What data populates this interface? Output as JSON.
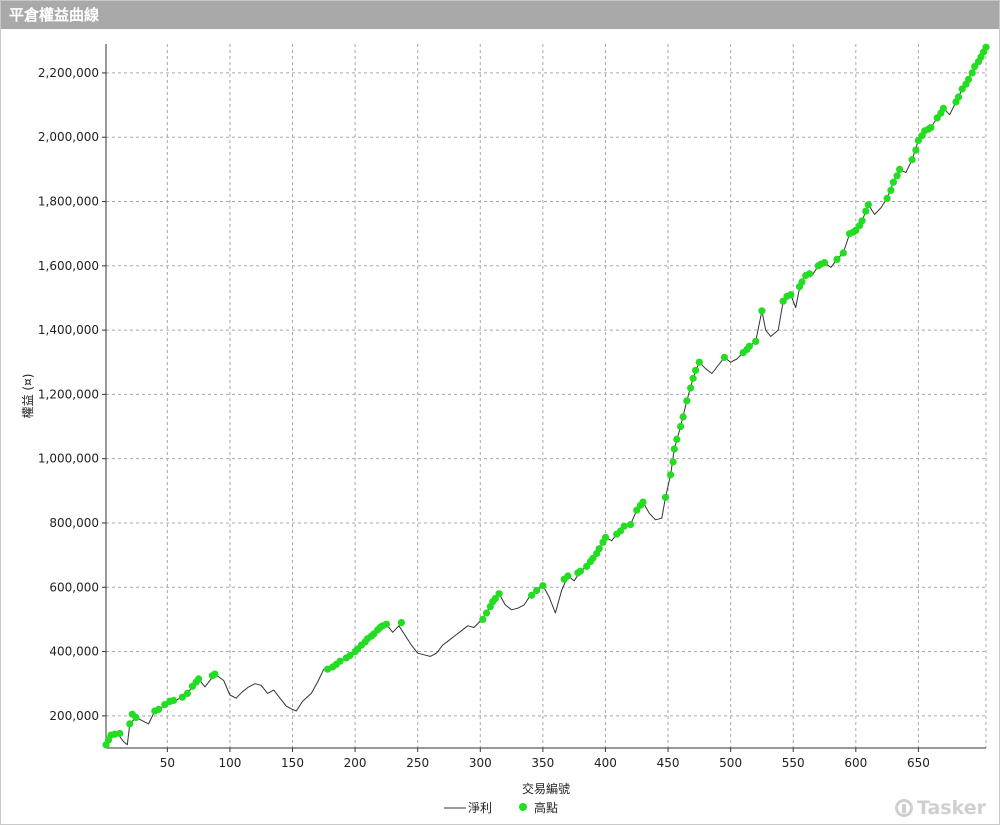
{
  "window": {
    "title": "平倉權益曲線"
  },
  "watermark": {
    "text": "Tasker"
  },
  "chart_data": {
    "type": "line",
    "ylabel": "權益 (¤)",
    "xlabel": "交易編號",
    "xlim": [
      1,
      704
    ],
    "ylim": [
      100000,
      2290000
    ],
    "x_ticks": [
      50,
      100,
      150,
      200,
      250,
      300,
      350,
      400,
      450,
      500,
      550,
      600,
      650
    ],
    "y_ticks": [
      200000,
      400000,
      600000,
      800000,
      1000000,
      1200000,
      1400000,
      1600000,
      1800000,
      2000000,
      2200000
    ],
    "y_tick_labels": [
      "200,000",
      "400,000",
      "600,000",
      "800,000",
      "1,000,000",
      "1,200,000",
      "1,400,000",
      "1,600,000",
      "1,800,000",
      "2,000,000",
      "2,200,000"
    ],
    "grid": true,
    "legend": {
      "position": "bottom",
      "items": [
        {
          "name": "淨利",
          "marker": "line",
          "color": "#333333"
        },
        {
          "name": "高點",
          "marker": "dot",
          "color": "#22dd22"
        }
      ]
    },
    "series": [
      {
        "name": "淨利",
        "color": "#333333",
        "points": [
          [
            1,
            110000
          ],
          [
            5,
            140000
          ],
          [
            10,
            145000
          ],
          [
            15,
            120000
          ],
          [
            18,
            110000
          ],
          [
            20,
            175000
          ],
          [
            25,
            195000
          ],
          [
            30,
            185000
          ],
          [
            35,
            175000
          ],
          [
            40,
            215000
          ],
          [
            45,
            225000
          ],
          [
            50,
            240000
          ],
          [
            55,
            245000
          ],
          [
            60,
            255000
          ],
          [
            65,
            265000
          ],
          [
            70,
            290000
          ],
          [
            75,
            315000
          ],
          [
            80,
            290000
          ],
          [
            88,
            330000
          ],
          [
            95,
            310000
          ],
          [
            100,
            265000
          ],
          [
            105,
            255000
          ],
          [
            110,
            275000
          ],
          [
            115,
            290000
          ],
          [
            120,
            300000
          ],
          [
            125,
            295000
          ],
          [
            130,
            270000
          ],
          [
            135,
            280000
          ],
          [
            140,
            255000
          ],
          [
            145,
            230000
          ],
          [
            150,
            220000
          ],
          [
            153,
            215000
          ],
          [
            158,
            245000
          ],
          [
            165,
            270000
          ],
          [
            170,
            305000
          ],
          [
            175,
            345000
          ],
          [
            185,
            360000
          ],
          [
            190,
            375000
          ],
          [
            195,
            385000
          ],
          [
            200,
            400000
          ],
          [
            205,
            420000
          ],
          [
            210,
            440000
          ],
          [
            215,
            455000
          ],
          [
            220,
            475000
          ],
          [
            225,
            485000
          ],
          [
            230,
            460000
          ],
          [
            235,
            480000
          ],
          [
            240,
            450000
          ],
          [
            245,
            420000
          ],
          [
            250,
            395000
          ],
          [
            255,
            390000
          ],
          [
            260,
            385000
          ],
          [
            265,
            395000
          ],
          [
            270,
            420000
          ],
          [
            275,
            435000
          ],
          [
            280,
            450000
          ],
          [
            285,
            465000
          ],
          [
            290,
            480000
          ],
          [
            295,
            475000
          ],
          [
            300,
            495000
          ],
          [
            305,
            520000
          ],
          [
            310,
            555000
          ],
          [
            315,
            580000
          ],
          [
            320,
            545000
          ],
          [
            325,
            530000
          ],
          [
            330,
            535000
          ],
          [
            335,
            545000
          ],
          [
            340,
            575000
          ],
          [
            345,
            590000
          ],
          [
            350,
            605000
          ],
          [
            355,
            570000
          ],
          [
            360,
            520000
          ],
          [
            365,
            590000
          ],
          [
            370,
            635000
          ],
          [
            375,
            620000
          ],
          [
            380,
            650000
          ],
          [
            385,
            665000
          ],
          [
            390,
            690000
          ],
          [
            395,
            720000
          ],
          [
            400,
            755000
          ],
          [
            405,
            745000
          ],
          [
            410,
            770000
          ],
          [
            415,
            790000
          ],
          [
            420,
            795000
          ],
          [
            425,
            840000
          ],
          [
            430,
            865000
          ],
          [
            435,
            830000
          ],
          [
            440,
            810000
          ],
          [
            445,
            815000
          ],
          [
            448,
            880000
          ],
          [
            452,
            950000
          ],
          [
            455,
            1030000
          ],
          [
            460,
            1100000
          ],
          [
            465,
            1180000
          ],
          [
            470,
            1250000
          ],
          [
            475,
            1300000
          ],
          [
            480,
            1280000
          ],
          [
            485,
            1265000
          ],
          [
            490,
            1290000
          ],
          [
            495,
            1315000
          ],
          [
            500,
            1300000
          ],
          [
            505,
            1310000
          ],
          [
            510,
            1330000
          ],
          [
            515,
            1350000
          ],
          [
            520,
            1365000
          ],
          [
            525,
            1460000
          ],
          [
            528,
            1400000
          ],
          [
            532,
            1380000
          ],
          [
            538,
            1400000
          ],
          [
            542,
            1490000
          ],
          [
            548,
            1510000
          ],
          [
            552,
            1470000
          ],
          [
            556,
            1550000
          ],
          [
            560,
            1570000
          ],
          [
            565,
            1570000
          ],
          [
            570,
            1600000
          ],
          [
            575,
            1610000
          ],
          [
            580,
            1595000
          ],
          [
            585,
            1620000
          ],
          [
            590,
            1640000
          ],
          [
            595,
            1700000
          ],
          [
            600,
            1710000
          ],
          [
            605,
            1740000
          ],
          [
            610,
            1790000
          ],
          [
            615,
            1760000
          ],
          [
            620,
            1780000
          ],
          [
            625,
            1810000
          ],
          [
            630,
            1860000
          ],
          [
            635,
            1900000
          ],
          [
            640,
            1890000
          ],
          [
            645,
            1930000
          ],
          [
            650,
            1990000
          ],
          [
            655,
            2020000
          ],
          [
            660,
            2030000
          ],
          [
            665,
            2060000
          ],
          [
            670,
            2090000
          ],
          [
            675,
            2070000
          ],
          [
            680,
            2110000
          ],
          [
            685,
            2150000
          ],
          [
            690,
            2180000
          ],
          [
            695,
            2220000
          ],
          [
            700,
            2250000
          ],
          [
            704,
            2280000
          ]
        ]
      },
      {
        "name": "高點",
        "color": "#22dd22",
        "points": [
          [
            1,
            110000
          ],
          [
            3,
            125000
          ],
          [
            5,
            140000
          ],
          [
            8,
            143000
          ],
          [
            12,
            145000
          ],
          [
            20,
            175000
          ],
          [
            22,
            205000
          ],
          [
            25,
            195000
          ],
          [
            40,
            215000
          ],
          [
            43,
            220000
          ],
          [
            48,
            235000
          ],
          [
            52,
            245000
          ],
          [
            55,
            248000
          ],
          [
            62,
            258000
          ],
          [
            66,
            270000
          ],
          [
            70,
            292000
          ],
          [
            73,
            305000
          ],
          [
            75,
            315000
          ],
          [
            86,
            325000
          ],
          [
            88,
            330000
          ],
          [
            178,
            345000
          ],
          [
            182,
            352000
          ],
          [
            185,
            360000
          ],
          [
            188,
            370000
          ],
          [
            193,
            380000
          ],
          [
            196,
            388000
          ],
          [
            200,
            400000
          ],
          [
            202,
            408000
          ],
          [
            205,
            420000
          ],
          [
            208,
            430000
          ],
          [
            210,
            440000
          ],
          [
            213,
            448000
          ],
          [
            215,
            455000
          ],
          [
            218,
            467000
          ],
          [
            220,
            475000
          ],
          [
            222,
            480000
          ],
          [
            225,
            485000
          ],
          [
            237,
            490000
          ],
          [
            302,
            500000
          ],
          [
            305,
            520000
          ],
          [
            308,
            540000
          ],
          [
            310,
            555000
          ],
          [
            312,
            565000
          ],
          [
            315,
            580000
          ],
          [
            341,
            575000
          ],
          [
            345,
            590000
          ],
          [
            350,
            605000
          ],
          [
            367,
            625000
          ],
          [
            370,
            635000
          ],
          [
            378,
            645000
          ],
          [
            380,
            650000
          ],
          [
            385,
            665000
          ],
          [
            388,
            680000
          ],
          [
            390,
            690000
          ],
          [
            393,
            705000
          ],
          [
            395,
            720000
          ],
          [
            398,
            740000
          ],
          [
            400,
            755000
          ],
          [
            409,
            765000
          ],
          [
            412,
            775000
          ],
          [
            415,
            790000
          ],
          [
            420,
            795000
          ],
          [
            425,
            840000
          ],
          [
            428,
            855000
          ],
          [
            430,
            865000
          ],
          [
            448,
            880000
          ],
          [
            452,
            950000
          ],
          [
            454,
            990000
          ],
          [
            455,
            1030000
          ],
          [
            457,
            1060000
          ],
          [
            460,
            1100000
          ],
          [
            462,
            1130000
          ],
          [
            465,
            1180000
          ],
          [
            468,
            1220000
          ],
          [
            470,
            1250000
          ],
          [
            472,
            1275000
          ],
          [
            475,
            1300000
          ],
          [
            495,
            1315000
          ],
          [
            510,
            1330000
          ],
          [
            513,
            1340000
          ],
          [
            515,
            1350000
          ],
          [
            520,
            1365000
          ],
          [
            525,
            1460000
          ],
          [
            542,
            1490000
          ],
          [
            545,
            1505000
          ],
          [
            548,
            1510000
          ],
          [
            555,
            1535000
          ],
          [
            557,
            1550000
          ],
          [
            560,
            1570000
          ],
          [
            563,
            1575000
          ],
          [
            570,
            1600000
          ],
          [
            572,
            1605000
          ],
          [
            575,
            1610000
          ],
          [
            585,
            1620000
          ],
          [
            590,
            1640000
          ],
          [
            595,
            1700000
          ],
          [
            598,
            1705000
          ],
          [
            600,
            1710000
          ],
          [
            603,
            1725000
          ],
          [
            605,
            1740000
          ],
          [
            608,
            1770000
          ],
          [
            610,
            1790000
          ],
          [
            625,
            1810000
          ],
          [
            628,
            1835000
          ],
          [
            630,
            1860000
          ],
          [
            633,
            1880000
          ],
          [
            635,
            1900000
          ],
          [
            645,
            1930000
          ],
          [
            648,
            1960000
          ],
          [
            650,
            1990000
          ],
          [
            653,
            2005000
          ],
          [
            655,
            2020000
          ],
          [
            658,
            2025000
          ],
          [
            660,
            2030000
          ],
          [
            665,
            2060000
          ],
          [
            668,
            2075000
          ],
          [
            670,
            2090000
          ],
          [
            680,
            2110000
          ],
          [
            682,
            2125000
          ],
          [
            685,
            2150000
          ],
          [
            688,
            2165000
          ],
          [
            690,
            2180000
          ],
          [
            693,
            2200000
          ],
          [
            695,
            2220000
          ],
          [
            698,
            2235000
          ],
          [
            700,
            2250000
          ],
          [
            702,
            2265000
          ],
          [
            704,
            2280000
          ]
        ]
      }
    ]
  }
}
